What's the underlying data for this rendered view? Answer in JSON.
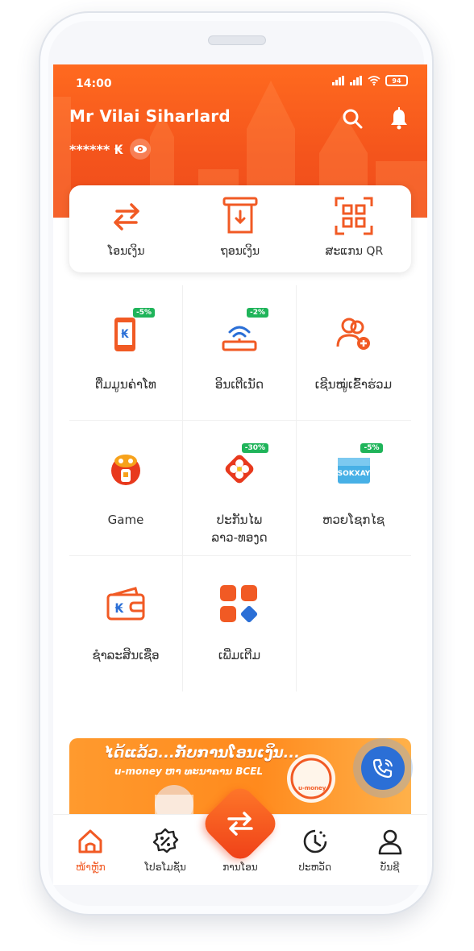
{
  "status_bar": {
    "time": "14:00",
    "battery": "94"
  },
  "header": {
    "user_name": "Mr Vilai Siharlard",
    "balance_masked": "****** ₭"
  },
  "quick_actions": [
    {
      "label": "ໂອນເງິນ",
      "icon": "transfer-arrows-icon"
    },
    {
      "label": "ຖອນເງິນ",
      "icon": "atm-withdraw-icon"
    },
    {
      "label": "ສະແກນ QR",
      "icon": "qr-scan-icon"
    }
  ],
  "services": [
    {
      "label": "ຕື່ມມູນຄ່າໂທ",
      "badge": "-5%",
      "icon": "phone-topup-icon"
    },
    {
      "label": "ອິນເຕີເນັດ",
      "badge": "-2%",
      "icon": "wifi-router-icon"
    },
    {
      "label": "ເຊີນໝູ່ເຂົ້າຮ່ວມ",
      "badge": "",
      "icon": "invite-friends-icon"
    },
    {
      "label": "Game",
      "badge": "",
      "icon": "game-icon"
    },
    {
      "label": "ປະກັນໄພ\nລາວ-ທອງດ",
      "badge": "-30%",
      "icon": "insurance-flower-icon"
    },
    {
      "label": "ຫວຍໂຊກໄຊ",
      "badge": "-5%",
      "icon": "lottery-ticket-icon"
    },
    {
      "label": "ຊຳລະສິນເຊື່ອ",
      "badge": "",
      "icon": "wallet-loan-icon"
    },
    {
      "label": "ເພີ່ມເຕີມ",
      "badge": "",
      "icon": "more-apps-icon"
    }
  ],
  "banner": {
    "title": "ໄດ້ແລ້ວ...ກັບການໂອນເງິນ...",
    "subtitle": "u-money ຫາ ທະນາຄານ BCEL",
    "logo_text": "u-money"
  },
  "bottom_nav": [
    {
      "label": "ໜ້າຫຼັກ",
      "icon": "home-icon",
      "active": true
    },
    {
      "label": "ໂປຣໂມຊັ່ນ",
      "icon": "promotion-icon",
      "active": false
    },
    {
      "label": "ການໂອນ",
      "icon": "transfer-icon",
      "active": false
    },
    {
      "label": "ປະຫວັດ",
      "icon": "history-icon",
      "active": false
    },
    {
      "label": "ບັນຊີ",
      "icon": "account-icon",
      "active": false
    }
  ],
  "colors": {
    "brand": "#f15a24",
    "green_badge": "#1fb45a",
    "fab_blue": "#2b6fd6"
  }
}
